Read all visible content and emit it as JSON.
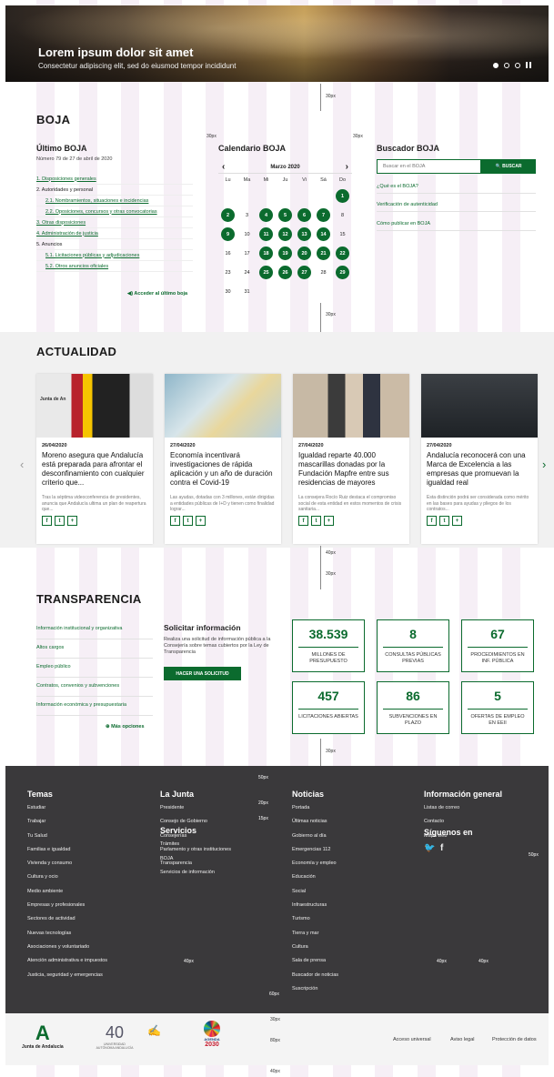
{
  "hero": {
    "title": "Lorem ipsum dolor sit amet",
    "subtitle": "Consectetur adipiscing elit, sed do eiusmod tempor incididunt"
  },
  "spec": {
    "s30": "30px",
    "s40": "40px",
    "s50": "50px",
    "s20": "20px",
    "s15": "15px",
    "s60": "60px",
    "s80": "80px"
  },
  "boja": {
    "heading": "BOJA",
    "last_title": "Último BOJA",
    "last_number": "Número 79 de 27 de abril de 2020",
    "items": [
      "1. Disposiciones generales",
      "2. Autoridades y personal",
      "2.1. Nombramientos, situaciones e incidencias",
      "2.2. Oposiciones, concursos y otras convocatorias",
      "3. Otras disposiciones",
      "4. Administración de justicia",
      "5. Anuncios",
      "5.1. Licitaciones públicas y adjudicaciones",
      "5.2. Otros anuncios oficiales"
    ],
    "access": "Acceder al último boja",
    "calendar_title": "Calendario BOJA",
    "month": "Marzo 2020",
    "dow": [
      "Lu",
      "Ma",
      "Mi",
      "Ju",
      "Vi",
      "Sá",
      "Do"
    ],
    "search_title": "Buscador BOJA",
    "search_placeholder": "Buscar en el BOJA",
    "search_button": "BUSCAR",
    "links": [
      "¿Qué es el BOJA?",
      "Verificación de autenticidad",
      "Cómo publicar en BOJA"
    ]
  },
  "actualidad": {
    "heading": "ACTUALIDAD",
    "cards": [
      {
        "date": "26/04/2020",
        "title": "Moreno asegura que Andalucía está preparada para afrontar el desconfinamiento con cualquier criterio que...",
        "summary": "Tras la séptima videoconferencia de presidentes, anuncia que Andalucía ultima un plan de reapertura que...",
        "logo": "Junta de An"
      },
      {
        "date": "27/04/2020",
        "title": "Economía incentivará investigaciones de rápida aplicación y un año de duración contra el Covid-19",
        "summary": "Las ayudas, dotadas con 3 millones, están dirigidas a entidades públicas de I+D y tienen como finalidad lograr..."
      },
      {
        "date": "27/04/2020",
        "title": "Igualdad reparte 40.000 mascarillas donadas por la Fundación Mapfre entre sus residencias de mayores",
        "summary": "La consejera Rocío Ruiz destaca el compromiso social de esta entidad en estos momentos de crisis sanitaria..."
      },
      {
        "date": "27/04/2020",
        "title": "Andalucía reconocerá con una Marca de Excelencia a las empresas que promuevan la igualdad real",
        "summary": "Esta distinción podrá ser considerada como mérito en las bases para ayudas y pliegos de los contratos..."
      }
    ]
  },
  "transparencia": {
    "heading": "TRANSPARENCIA",
    "links": [
      "Información institucional y organizativa",
      "Altos cargos",
      "Empleo público",
      "Contratos, convenios y subvenciones",
      "Información económica y presupuestaria"
    ],
    "more": "Más opciones",
    "request_title": "Solicitar información",
    "request_text": "Realiza una solicitud de información pública a la Consejería sobre temas cubiertos por la Ley de Transparencia",
    "request_button": "HACER UNA SOLICITUD",
    "stats": [
      {
        "n": "38.539",
        "l": "MILLONES DE PRESUPUESTO"
      },
      {
        "n": "8",
        "l": "CONSULTAS PÚBLICAS PREVIAS"
      },
      {
        "n": "67",
        "l": "PROCEDIMIENTOS EN INF. PÚBLICA"
      },
      {
        "n": "457",
        "l": "LICITACIONES ABIERTAS"
      },
      {
        "n": "86",
        "l": "SUBVENCIONES EN PLAZO"
      },
      {
        "n": "5",
        "l": "OFERTAS DE EMPLEO EN EEII"
      }
    ]
  },
  "footer": {
    "temas_title": "Temas",
    "temas": [
      "Estudiar",
      "Trabajar",
      "Tu Salud",
      "Familias e igualdad",
      "Vivienda y consumo",
      "Cultura y ocio",
      "Medio ambiente",
      "Empresas y profesionales",
      "Sectores de actividad",
      "Nuevas tecnologías",
      "Asociaciones y voluntariado",
      "Atención administrativa e impuestos",
      "Justicia, seguridad y emergencias"
    ],
    "junta_title": "La Junta",
    "junta": [
      "Presidente",
      "Consejo de Gobierno",
      "Consejerías",
      "Parlamento y otras instituciones",
      "Transparencia"
    ],
    "servicios_title": "Servicios",
    "servicios": [
      "Trámites",
      "BOJA",
      "Servicios de información"
    ],
    "noticias_title": "Noticias",
    "noticias": [
      "Portada",
      "Últimas noticias",
      "Gobierno al día",
      "Emergencias 112",
      "Economía y empleo",
      "Educación",
      "Social",
      "Infraestructuras",
      "Turismo",
      "Tierra y mar",
      "Cultura",
      "Sala de prensa",
      "Buscador de noticias",
      "Suscripción"
    ],
    "info_title": "Información general",
    "info": [
      "Listas de correo",
      "Contacto",
      "Mapa web"
    ],
    "social_title": "Síguenos en",
    "logo_text": "Junta de Andalucía",
    "univ_text": "UNIVERSIDAD AUTÓNOMA ANDALUCÍA",
    "agenda_text": "AGENDA",
    "agenda_year": "2030",
    "legal": [
      "Acceso universal",
      "Aviso legal",
      "Protección de datos"
    ]
  }
}
